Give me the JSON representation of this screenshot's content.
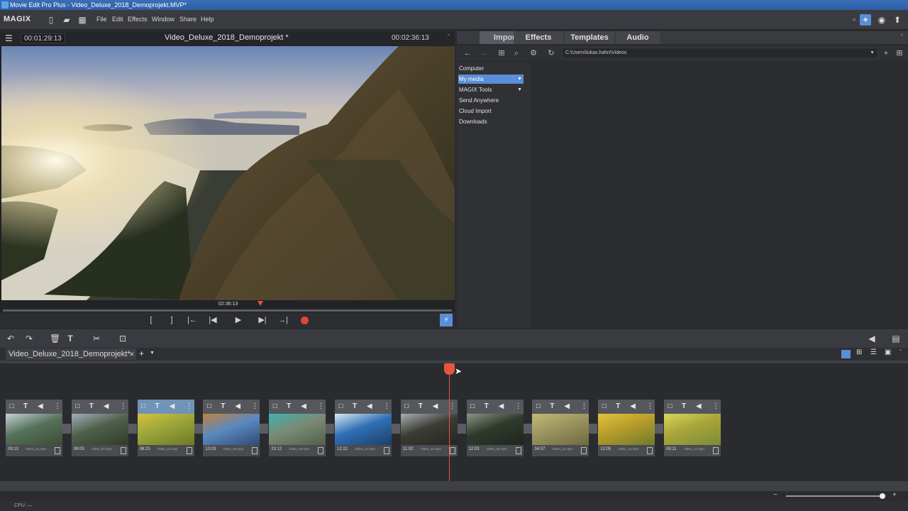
{
  "window": {
    "title": "Movie Edit Pro Plus - Video_Deluxe_2018_Demoprojekt.MVP*"
  },
  "menubar": {
    "logo": "MAGIX",
    "items": [
      "File",
      "Edit",
      "Effects",
      "Window",
      "Share",
      "Help"
    ]
  },
  "preview": {
    "timecode_current": "00:01:29:13",
    "project_title": "Video_Deluxe_2018_Demoprojekt *",
    "timecode_total": "00:02:36:13",
    "scrub_time": "02:36:13"
  },
  "media_pool": {
    "tabs": [
      "Import",
      "Effects",
      "Templates",
      "Audio"
    ],
    "active_tab": "Import",
    "path": "C:\\Users\\lukas.hahn\\Videos",
    "nav_items": [
      {
        "label": "Computer"
      },
      {
        "label": "My media"
      },
      {
        "label": "MAGIX Tools"
      },
      {
        "label": "Send Anywhere"
      },
      {
        "label": "Cloud Import"
      },
      {
        "label": "Downloads"
      }
    ]
  },
  "timeline": {
    "project_tab": "Video_Deluxe_2018_Demoprojekt*",
    "clips": [
      {
        "duration": "09:13",
        "file": "Video_01.mp4"
      },
      {
        "duration": "08:03",
        "file": "Video_02.mp4"
      },
      {
        "duration": "08:23",
        "file": "Video_16.mp4"
      },
      {
        "duration": "13:03",
        "file": "Video_08.mp4"
      },
      {
        "duration": "23:12",
        "file": "Video_04.mp4"
      },
      {
        "duration": "12:22",
        "file": "Video_14.mp4"
      },
      {
        "duration": "11:02",
        "file": "Video_15.mp4"
      },
      {
        "duration": "12:03",
        "file": "Video_05.mp4"
      },
      {
        "duration": "34:07",
        "file": "Video_11.mp4"
      },
      {
        "duration": "12:05",
        "file": "Video_14.mp4"
      },
      {
        "duration": "08:11",
        "file": "Video_17.mp4"
      }
    ]
  },
  "status": {
    "cpu": "CPU: —"
  },
  "colors": {
    "accent": "#e8543f",
    "selection": "#5a8ed6"
  }
}
